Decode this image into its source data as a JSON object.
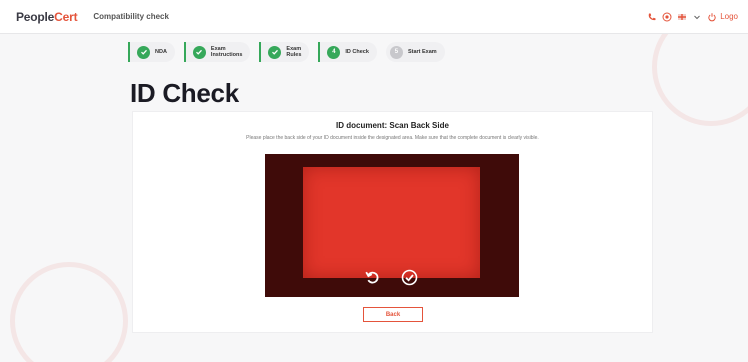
{
  "header": {
    "brand_main": "People",
    "brand_accent": "Cert",
    "app_title": "Compatibility check",
    "logout_label": "Logo"
  },
  "stepper": {
    "steps": [
      {
        "label_1": "NDA",
        "label_2": "",
        "state": "done"
      },
      {
        "label_1": "Exam",
        "label_2": "Instructions",
        "state": "done"
      },
      {
        "label_1": "Exam",
        "label_2": "Rules",
        "state": "done"
      },
      {
        "label_1": "ID Check",
        "label_2": "",
        "number": "4",
        "state": "current"
      },
      {
        "label_1": "Start Exam",
        "label_2": "",
        "number": "5",
        "state": "pending"
      }
    ]
  },
  "page": {
    "title": "ID Check"
  },
  "card": {
    "title": "ID document: Scan Back Side",
    "instruction": "Please place the back side of your ID document inside the designated area. Make sure that the complete document is clearly visible."
  },
  "actions": {
    "back_label": "Back"
  },
  "icons": {
    "retake": "rotate-ccw-icon",
    "confirm": "check-circle-icon"
  },
  "colors": {
    "accent": "#e4543b",
    "success": "#36a85a",
    "camera_frame": "#3f0b09",
    "scan_area": "#e2362a"
  }
}
